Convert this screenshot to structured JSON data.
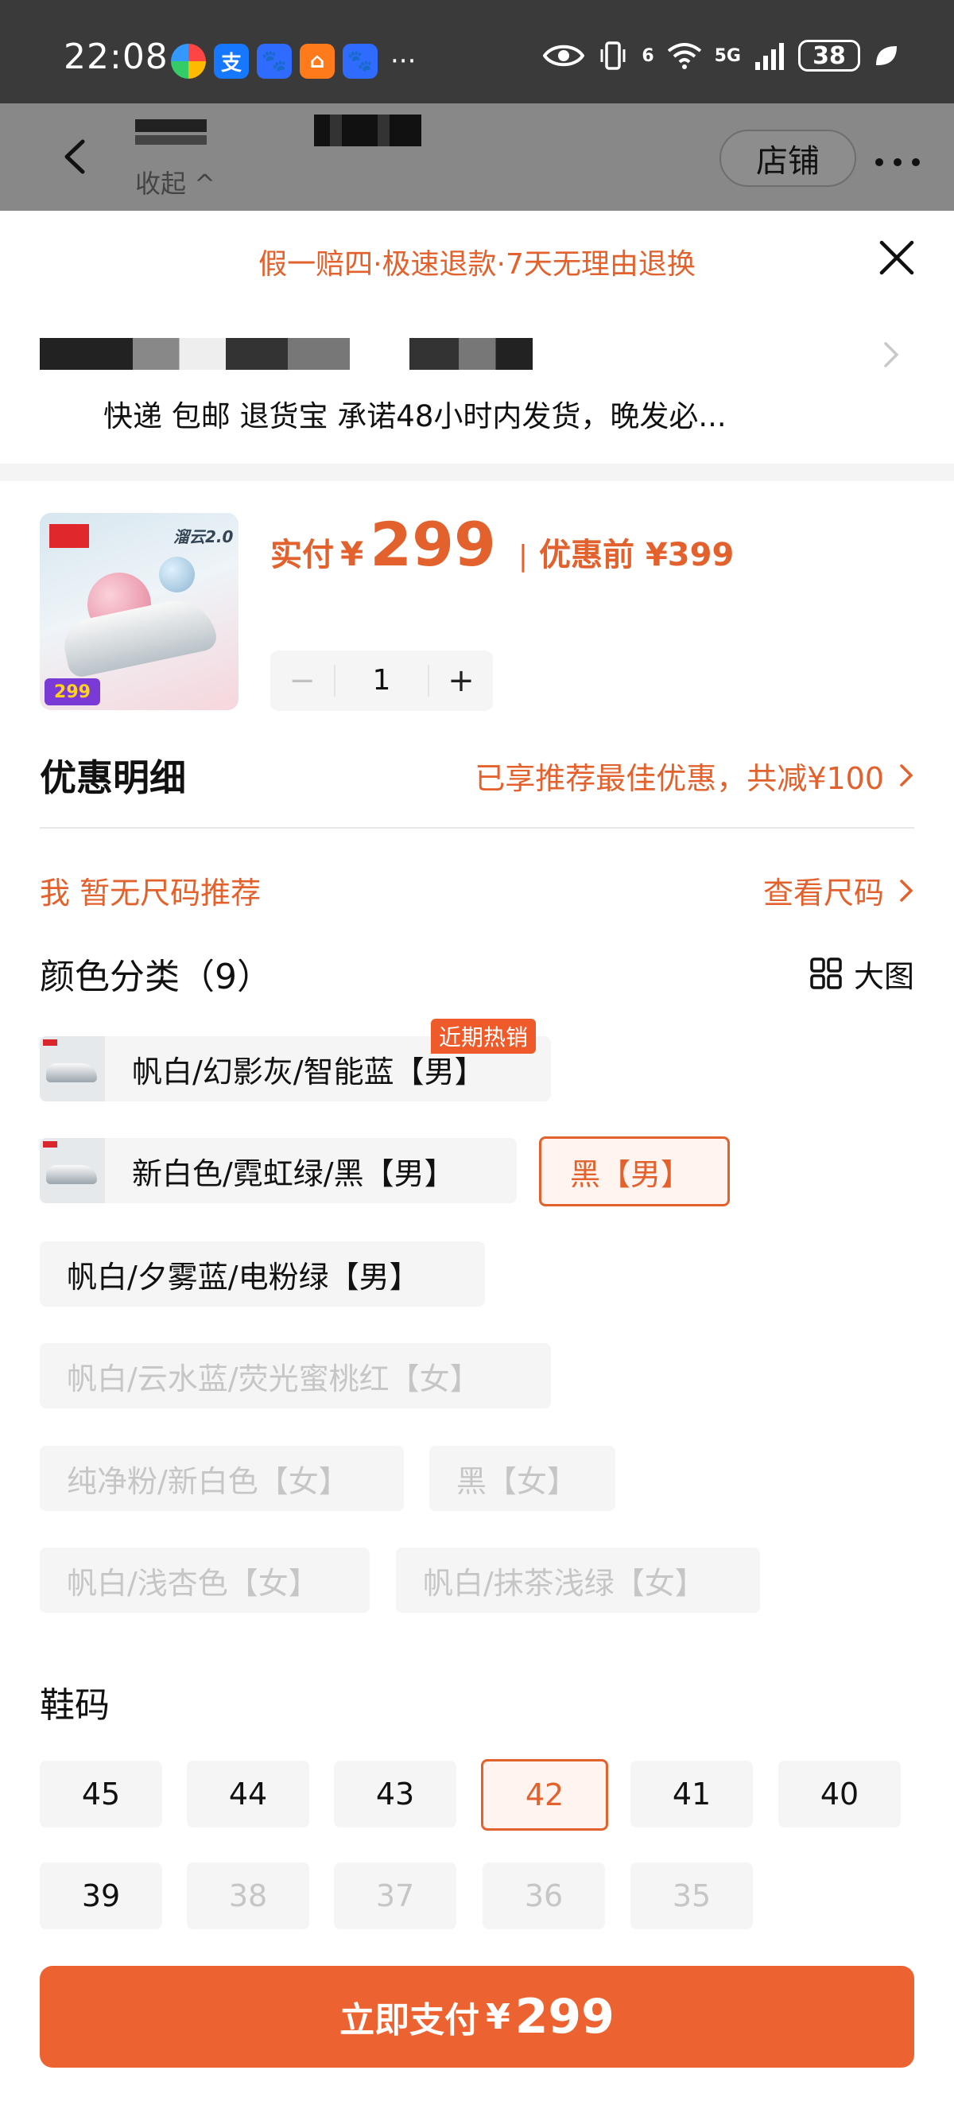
{
  "status_bar": {
    "time": "22:08",
    "net_label": "5G",
    "wifi_label": "6",
    "battery": "38",
    "more": "···"
  },
  "header": {
    "collapse": "收起 ^",
    "store_button": "店铺"
  },
  "sheet": {
    "guarantee": "假一赔四·极速退款·7天无理由退换",
    "delivery": "快递 包邮 退货宝 承诺48小时内发货，晚发必..."
  },
  "product": {
    "image_brand": "溜云2.0",
    "image_price_tag": "299",
    "price_label": "实付",
    "currency": "¥",
    "price": "299",
    "price_sep": "|",
    "price_before": "优惠前 ¥399",
    "quantity": "1",
    "qty_minus": "−",
    "qty_plus": "+"
  },
  "discount": {
    "title": "优惠明细",
    "value": "已享推荐最佳优惠，共减¥100"
  },
  "size_recommend": {
    "left": "我 暂无尺码推荐",
    "right": "查看尺码"
  },
  "colors": {
    "title": "颜色分类（9）",
    "big_image": "大图",
    "hot_badge": "近期热销",
    "items": [
      {
        "label": "帆白/幻影灰/智能蓝【男】",
        "state": "normal"
      },
      {
        "label": "新白色/霓虹绿/黑【男】",
        "state": "normal"
      },
      {
        "label": "黑【男】",
        "state": "selected"
      },
      {
        "label": "帆白/夕雾蓝/电粉绿【男】",
        "state": "normal"
      },
      {
        "label": "帆白/云水蓝/荧光蜜桃红【女】",
        "state": "disabled"
      },
      {
        "label": "纯净粉/新白色【女】",
        "state": "disabled"
      },
      {
        "label": "黑【女】",
        "state": "disabled"
      },
      {
        "label": "帆白/浅杏色【女】",
        "state": "disabled"
      },
      {
        "label": "帆白/抹茶浅绿【女】",
        "state": "disabled"
      }
    ]
  },
  "sizes": {
    "title": "鞋码",
    "items": [
      {
        "label": "45",
        "state": "normal"
      },
      {
        "label": "44",
        "state": "normal"
      },
      {
        "label": "43",
        "state": "normal"
      },
      {
        "label": "42",
        "state": "selected"
      },
      {
        "label": "41",
        "state": "normal"
      },
      {
        "label": "40",
        "state": "normal"
      },
      {
        "label": "39",
        "state": "normal"
      },
      {
        "label": "38",
        "state": "disabled"
      },
      {
        "label": "37",
        "state": "disabled"
      },
      {
        "label": "36",
        "state": "disabled"
      },
      {
        "label": "35",
        "state": "disabled"
      }
    ]
  },
  "pay": {
    "label": "立即支付",
    "currency": "¥",
    "amount": "299"
  },
  "theme": {
    "accent": "#e2612c",
    "pay_button": "#ec6331",
    "status_bar_bg": "#3a3a3a",
    "chip_bg": "#f5f5f5"
  }
}
